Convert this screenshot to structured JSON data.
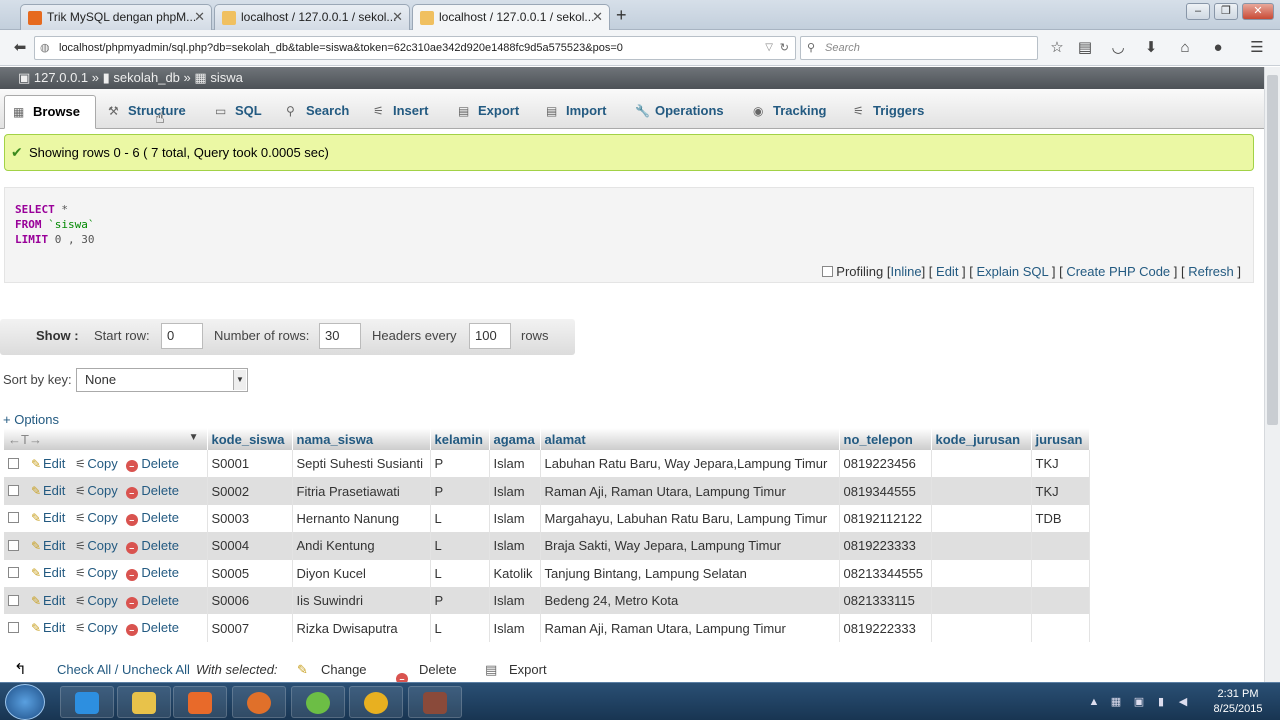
{
  "browser": {
    "tabs": [
      {
        "title": "Trik MySQL dengan phpM...",
        "active": false
      },
      {
        "title": "localhost / 127.0.0.1 / sekol...",
        "active": false
      },
      {
        "title": "localhost / 127.0.0.1 / sekol...",
        "active": true
      }
    ],
    "new_tab": "+",
    "url": "localhost/phpmyadmin/sql.php?db=sekolah_db&table=siswa&token=62c310ae342d920e1488fc9d5a575523&pos=0",
    "search_placeholder": "Search"
  },
  "breadcrumb": {
    "server": "127.0.0.1",
    "sep1": "»",
    "database": "sekolah_db",
    "sep2": "»",
    "table": "siswa"
  },
  "menu": {
    "browse": "Browse",
    "structure": "Structure",
    "sql": "SQL",
    "search": "Search",
    "insert": "Insert",
    "export": "Export",
    "import": "Import",
    "operations": "Operations",
    "tracking": "Tracking",
    "triggers": "Triggers"
  },
  "message": "Showing rows 0 - 6 ( 7 total, Query took 0.0005 sec)",
  "sql": {
    "select_kw": "SELECT",
    "select_val": "*",
    "from_kw": "FROM",
    "from_val": "`siswa`",
    "limit_kw": "LIMIT",
    "limit_val": "0 , 30"
  },
  "sql_footer": {
    "profiling": "Profiling",
    "inline": "Inline",
    "edit": "Edit",
    "explain": "Explain SQL",
    "php": "Create PHP Code",
    "refresh": "Refresh"
  },
  "show_bar": {
    "show": "Show :",
    "start_row_label": "Start row:",
    "start_row": "0",
    "num_rows_label": "Number of rows:",
    "num_rows": "30",
    "headers_label": "Headers every",
    "headers": "100",
    "rows_label": "rows"
  },
  "sort": {
    "label": "Sort by key:",
    "value": "None"
  },
  "options": "+ Options",
  "columns": [
    "kode_siswa",
    "nama_siswa",
    "kelamin",
    "agama",
    "alamat",
    "no_telepon",
    "kode_jurusan",
    "jurusan"
  ],
  "actions": {
    "edit": "Edit",
    "copy": "Copy",
    "delete": "Delete"
  },
  "rows": [
    [
      "S0001",
      "Septi Suhesti Susianti",
      "P",
      "Islam",
      "Labuhan Ratu Baru, Way Jepara,Lampung Timur",
      "0819223456",
      "",
      "TKJ"
    ],
    [
      "S0002",
      "Fitria Prasetiawati",
      "P",
      "Islam",
      "Raman Aji, Raman Utara, Lampung Timur",
      "0819344555",
      "",
      "TKJ"
    ],
    [
      "S0003",
      "Hernanto Nanung",
      "L",
      "Islam",
      "Margahayu, Labuhan Ratu Baru, Lampung Timur",
      "08192112122",
      "",
      "TDB"
    ],
    [
      "S0004",
      "Andi Kentung",
      "L",
      "Islam",
      "Braja Sakti, Way Jepara, Lampung Timur",
      "0819223333",
      "",
      ""
    ],
    [
      "S0005",
      "Diyon Kucel",
      "L",
      "Katolik",
      "Tanjung Bintang, Lampung Selatan",
      "08213344555",
      "",
      ""
    ],
    [
      "S0006",
      "Iis Suwindri",
      "P",
      "Islam",
      "Bedeng 24, Metro Kota",
      "0821333115",
      "",
      ""
    ],
    [
      "S0007",
      "Rizka Dwisaputra",
      "L",
      "Islam",
      "Raman Aji, Raman Utara, Lampung Timur",
      "0819222333",
      "",
      ""
    ]
  ],
  "bottom": {
    "check_all": "Check All / Uncheck All",
    "with_selected": "With selected:",
    "change": "Change",
    "delete": "Delete",
    "export": "Export"
  },
  "clock": {
    "time": "2:31 PM",
    "date": "8/25/2015"
  }
}
